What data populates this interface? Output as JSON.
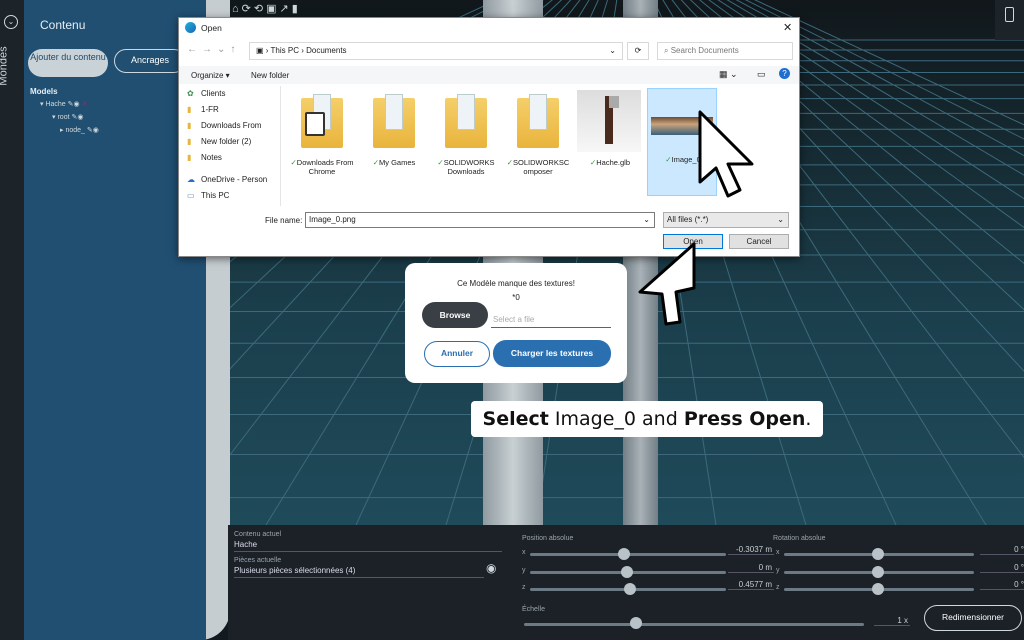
{
  "rail": {
    "label": "Mondes",
    "toggle_icon": "chevron-down-circle-icon"
  },
  "sidebar": {
    "title": "Contenu",
    "add_button": "Ajouter du contenu",
    "anchors_button": "Ancrages",
    "models_label": "Models",
    "tree": [
      {
        "label": "Hache"
      },
      {
        "label": "root"
      },
      {
        "label": "node_"
      }
    ]
  },
  "bottom": {
    "current_label": "Contenu actuel",
    "current_value": "Hache",
    "pieces_label": "Pièces actuelle",
    "pieces_value": "Plusieurs pièces sélectionnées (4)",
    "position_label": "Position absolue",
    "rotation_label": "Rotation absolue",
    "scale_label": "Échelle",
    "pos": [
      {
        "axis": "x",
        "value": "-0.3037",
        "unit": "m"
      },
      {
        "axis": "y",
        "value": "0",
        "unit": "m"
      },
      {
        "axis": "z",
        "value": "0.4577",
        "unit": "m"
      }
    ],
    "rot": [
      {
        "axis": "x",
        "value": "0",
        "unit": "°"
      },
      {
        "axis": "y",
        "value": "0",
        "unit": "°"
      },
      {
        "axis": "z",
        "value": "0",
        "unit": "°"
      }
    ],
    "scale_value": "1",
    "scale_unit": "x",
    "resize_button": "Redimensionner"
  },
  "dialog": {
    "title": "Open",
    "breadcrumb": [
      "This PC",
      "Documents"
    ],
    "search_placeholder": "Search Documents",
    "organize": "Organize ▾",
    "new_folder": "New folder",
    "nav": [
      "Clients",
      "1-FR",
      "Downloads From",
      "New folder (2)",
      "Notes",
      "OneDrive - Person",
      "This PC"
    ],
    "files": [
      {
        "name": "Downloads From Chrome",
        "kind": "folder-doc"
      },
      {
        "name": "My Games",
        "kind": "folder"
      },
      {
        "name": "SOLIDWORKS Downloads",
        "kind": "folder"
      },
      {
        "name": "SOLIDWORKSC omposer",
        "kind": "folder"
      },
      {
        "name": "Hache.glb",
        "kind": "model"
      },
      {
        "name": "Image_0",
        "kind": "image"
      }
    ],
    "filename_label": "File name:",
    "filename_value": "Image_0.png",
    "filter_value": "All files (*.*)",
    "open_button": "Open",
    "cancel_button": "Cancel"
  },
  "popup": {
    "message": "Ce Modèle manque des textures!",
    "count": "*0",
    "browse_button": "Browse",
    "file_placeholder": "Select a file",
    "cancel_button": "Annuler",
    "load_button": "Charger les textures"
  },
  "caption": {
    "part1": "Select",
    "part2": " Image_0 and ",
    "part3": "Press Open",
    "part4": "."
  },
  "colors": {
    "accent": "#2a6fb0",
    "sidebar": "#204f72",
    "dark_button": "#3a3f45"
  }
}
